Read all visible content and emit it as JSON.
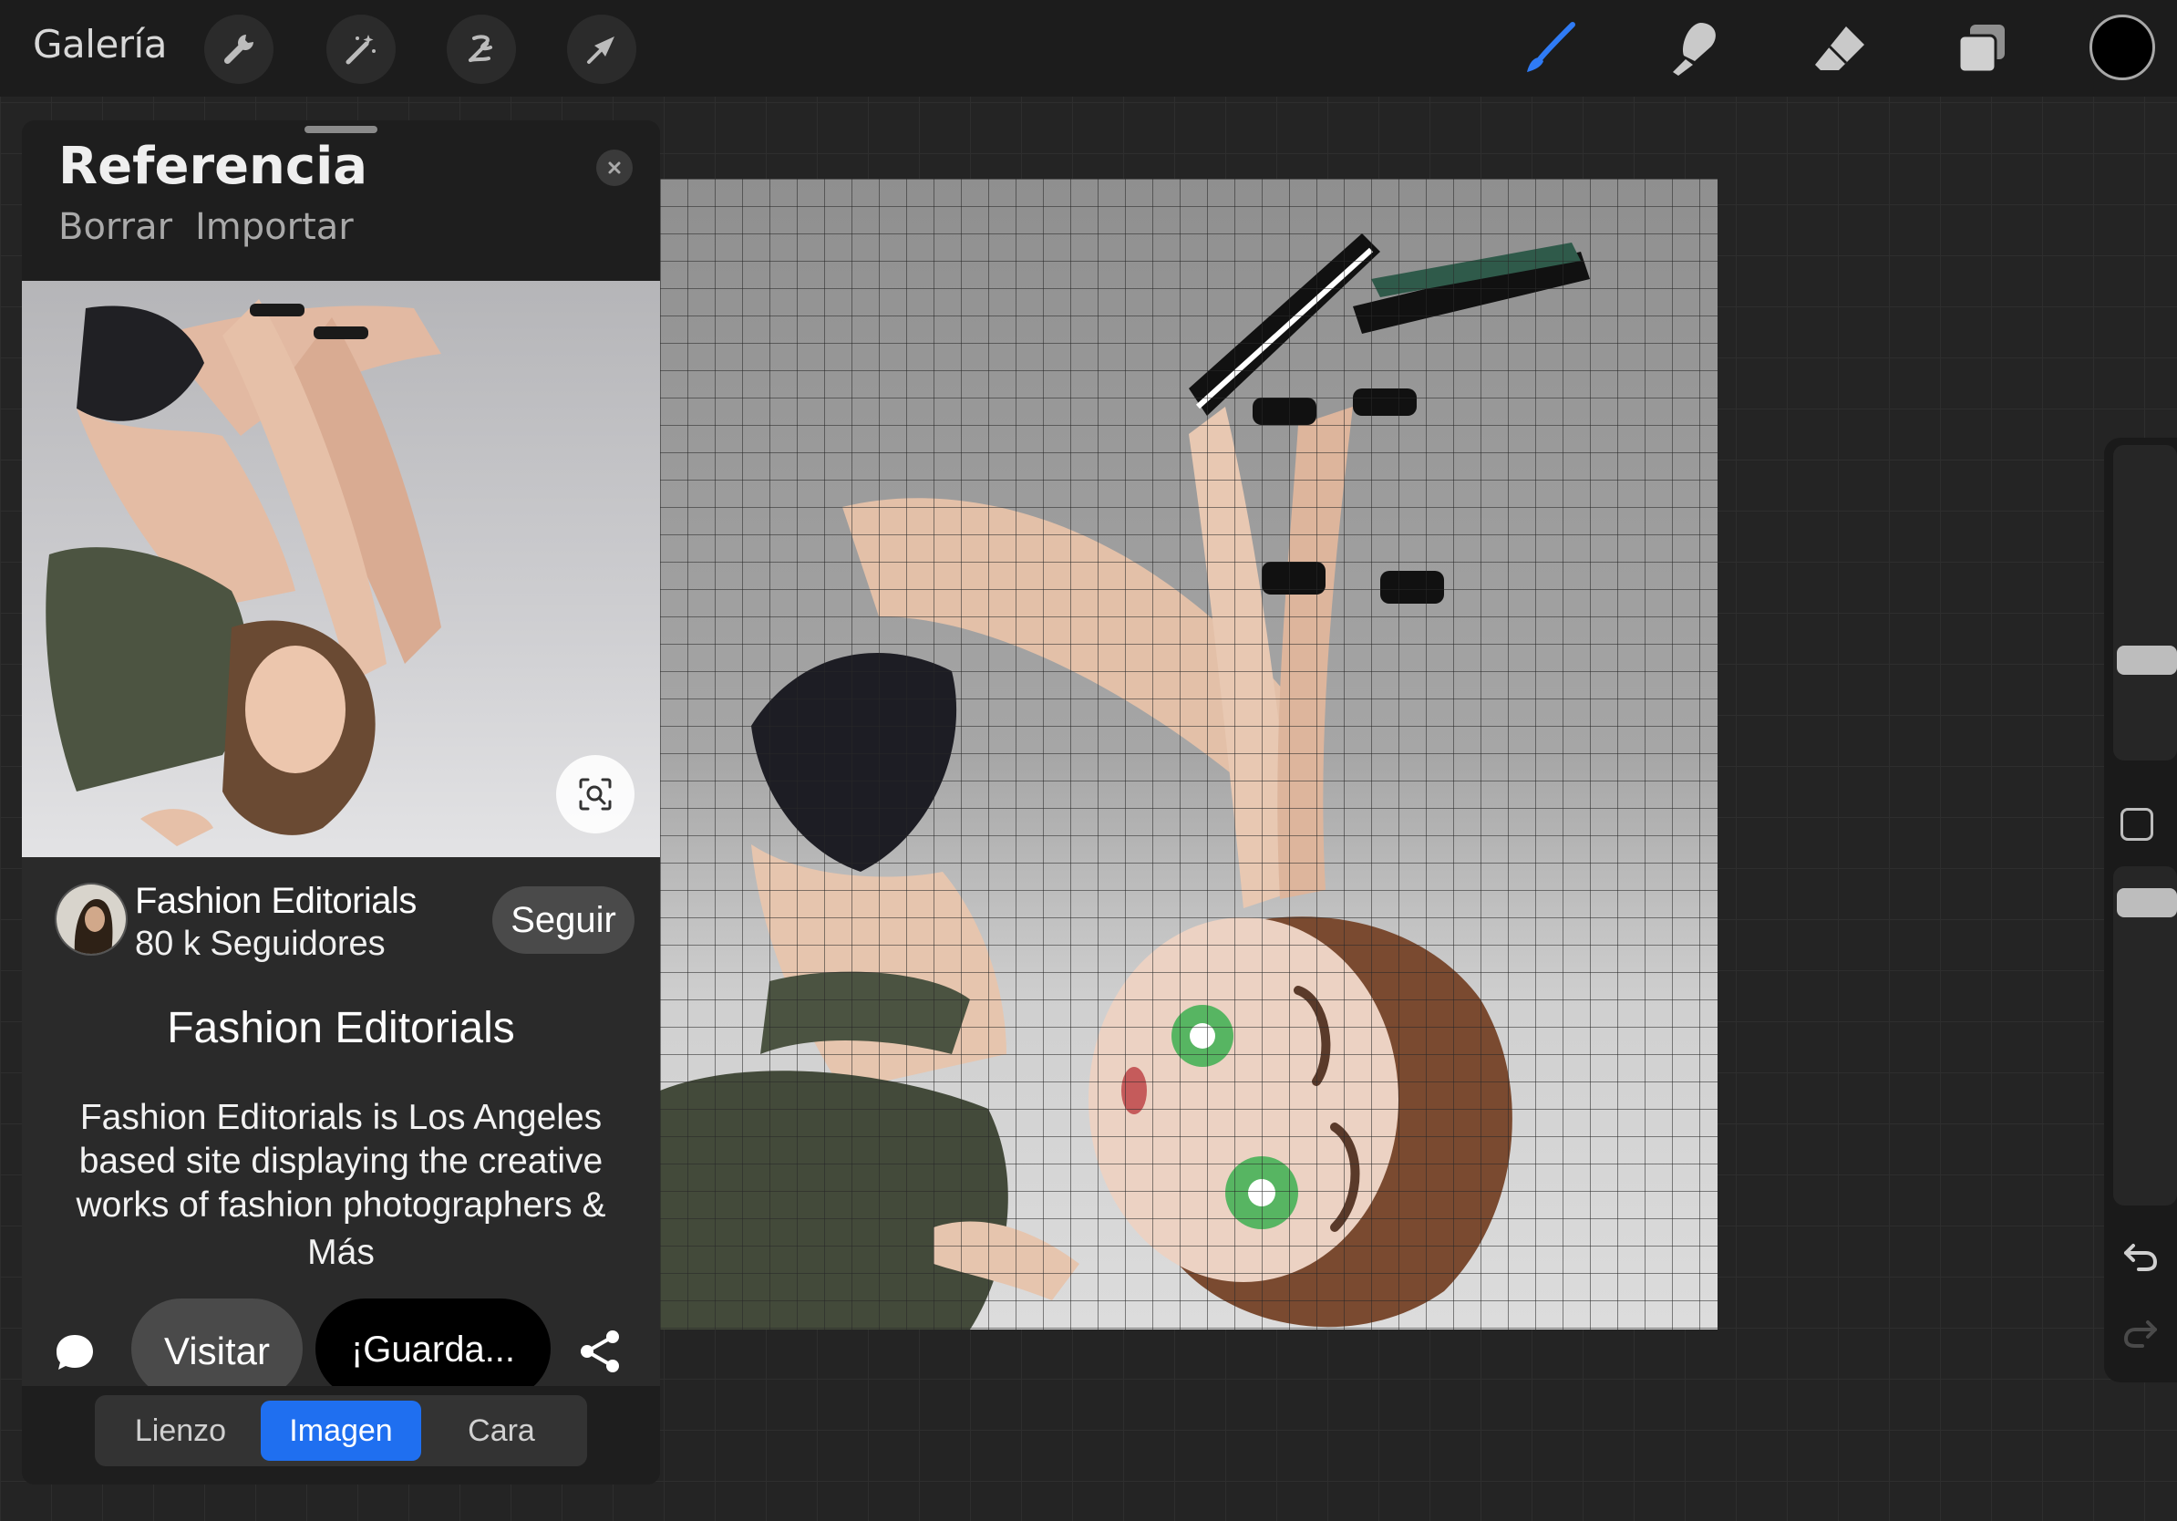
{
  "toolbar": {
    "gallery_label": "Galería",
    "left_tools": [
      "wrench-icon",
      "magic-wand-icon",
      "selection-icon",
      "transform-arrow-icon"
    ],
    "right_tools": [
      "brush-icon",
      "smudge-icon",
      "eraser-icon",
      "layers-icon"
    ],
    "active_tool": "brush-icon",
    "accent_color": "#2f7bf5",
    "current_color": "#000000"
  },
  "reference_panel": {
    "title": "Referencia",
    "actions": [
      "Borrar",
      "Importar"
    ],
    "pin": {
      "author_name": "Fashion Editorials",
      "author_followers": "80 k Seguidores",
      "follow_label": "Seguir",
      "title": "Fashion Editorials",
      "description": "Fashion Editorials is Los Angeles based site displaying the creative works of fashion photographers &",
      "more_label": "Más",
      "visit_label": "Visitar",
      "save_label": "¡Guarda..."
    },
    "tabs": [
      {
        "label": "Lienzo",
        "active": false
      },
      {
        "label": "Imagen",
        "active": true
      },
      {
        "label": "Cara",
        "active": false
      }
    ]
  }
}
